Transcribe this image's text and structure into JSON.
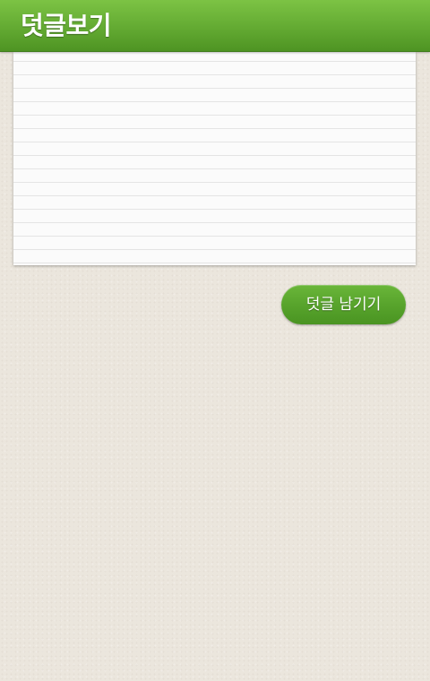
{
  "header": {
    "title": "덧글보기"
  },
  "comment_area": {
    "comments": []
  },
  "actions": {
    "reply_label": "덧글 남기기"
  },
  "colors": {
    "header_green": "#63aa32",
    "button_green": "#58a42c",
    "background": "#ebe6dd",
    "sheet": "#fbfbfb"
  }
}
